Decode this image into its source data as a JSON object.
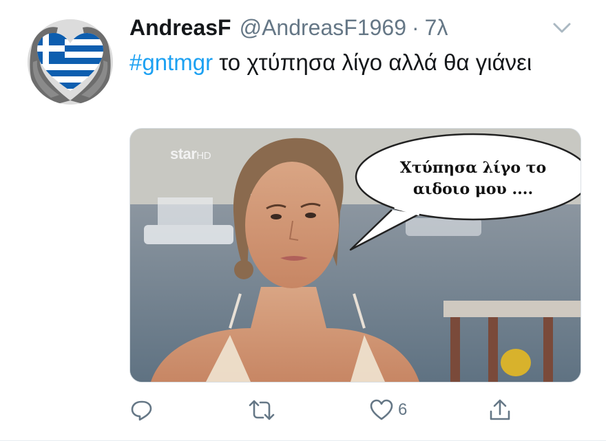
{
  "tweet": {
    "display_name": "AndreasF",
    "handle": "@AndreasF1969",
    "separator": "·",
    "time": "7λ",
    "hashtag": "#gntmgr",
    "text_rest": " το χτύπησα λίγο αλλά θα γιάνει"
  },
  "media": {
    "watermark": "star",
    "watermark_suffix": "HD",
    "bubble_line1": "Χτύπησα λίγο το",
    "bubble_line2": "αιδοιο μου ...."
  },
  "actions": {
    "reply_icon": "reply-icon",
    "retweet_icon": "retweet-icon",
    "like_icon": "heart-icon",
    "like_count": "6",
    "share_icon": "share-icon"
  },
  "colors": {
    "link": "#1da1f2",
    "text": "#14171a",
    "muted": "#657786",
    "flag_blue": "#0d5eaf"
  }
}
